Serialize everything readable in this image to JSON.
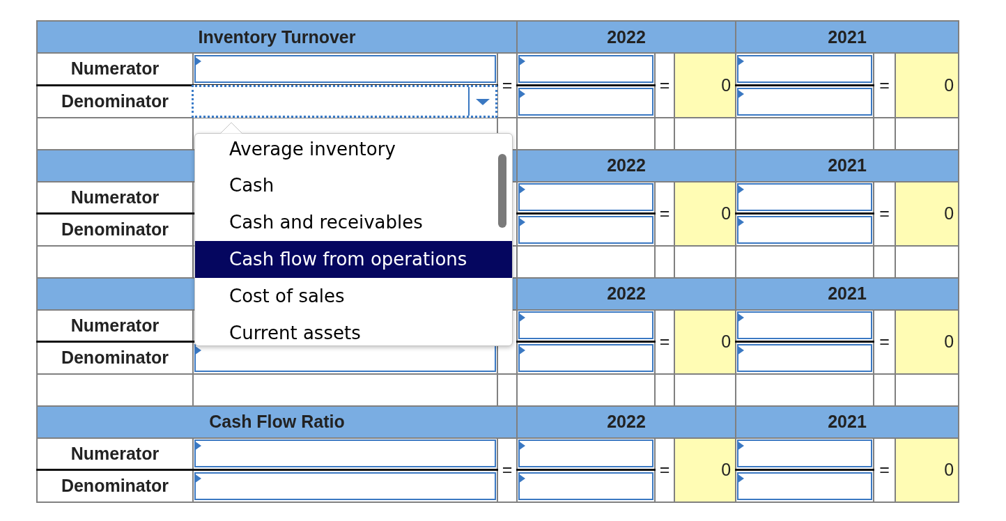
{
  "sections": [
    {
      "title": "Inventory Turnover",
      "equals": "=",
      "rows": [
        {
          "label": "Numerator",
          "select": {
            "focused": false
          }
        },
        {
          "label": "Denominator",
          "select": {
            "focused": true,
            "menu": {
              "options": [
                {
                  "label": "Average inventory",
                  "selected": false
                },
                {
                  "label": "Cash",
                  "selected": false
                },
                {
                  "label": "Cash and receivables",
                  "selected": false
                },
                {
                  "label": "Cash flow from operations",
                  "selected": true
                },
                {
                  "label": "Cost of sales",
                  "selected": false
                },
                {
                  "label": "Current assets",
                  "selected": false
                }
              ]
            }
          }
        }
      ],
      "years": [
        {
          "heading": "2022",
          "equals": "=",
          "result": "0"
        },
        {
          "heading": "2021",
          "equals": "=",
          "result": "0"
        }
      ]
    },
    {
      "rows": [
        {
          "label": "Numerator"
        },
        {
          "label": "Denominator"
        }
      ],
      "years": [
        {
          "heading": "2022",
          "equals": "=",
          "result": "0"
        },
        {
          "heading": "2021",
          "equals": "=",
          "result": "0"
        }
      ]
    },
    {
      "rows": [
        {
          "label": "Numerator"
        },
        {
          "label": "Denominator",
          "select": {
            "focused": false
          }
        }
      ],
      "years": [
        {
          "heading": "2022",
          "equals": "=",
          "result": "0"
        },
        {
          "heading": "2021",
          "equals": "=",
          "result": "0"
        }
      ]
    },
    {
      "title": "Cash Flow Ratio",
      "equals": "=",
      "rows": [
        {
          "label": "Numerator",
          "select": {
            "focused": false
          }
        },
        {
          "label": "Denominator",
          "select": {
            "focused": false
          }
        }
      ],
      "years": [
        {
          "heading": "2022",
          "equals": "=",
          "result": "0"
        },
        {
          "heading": "2021",
          "equals": "=",
          "result": "0"
        }
      ]
    }
  ]
}
